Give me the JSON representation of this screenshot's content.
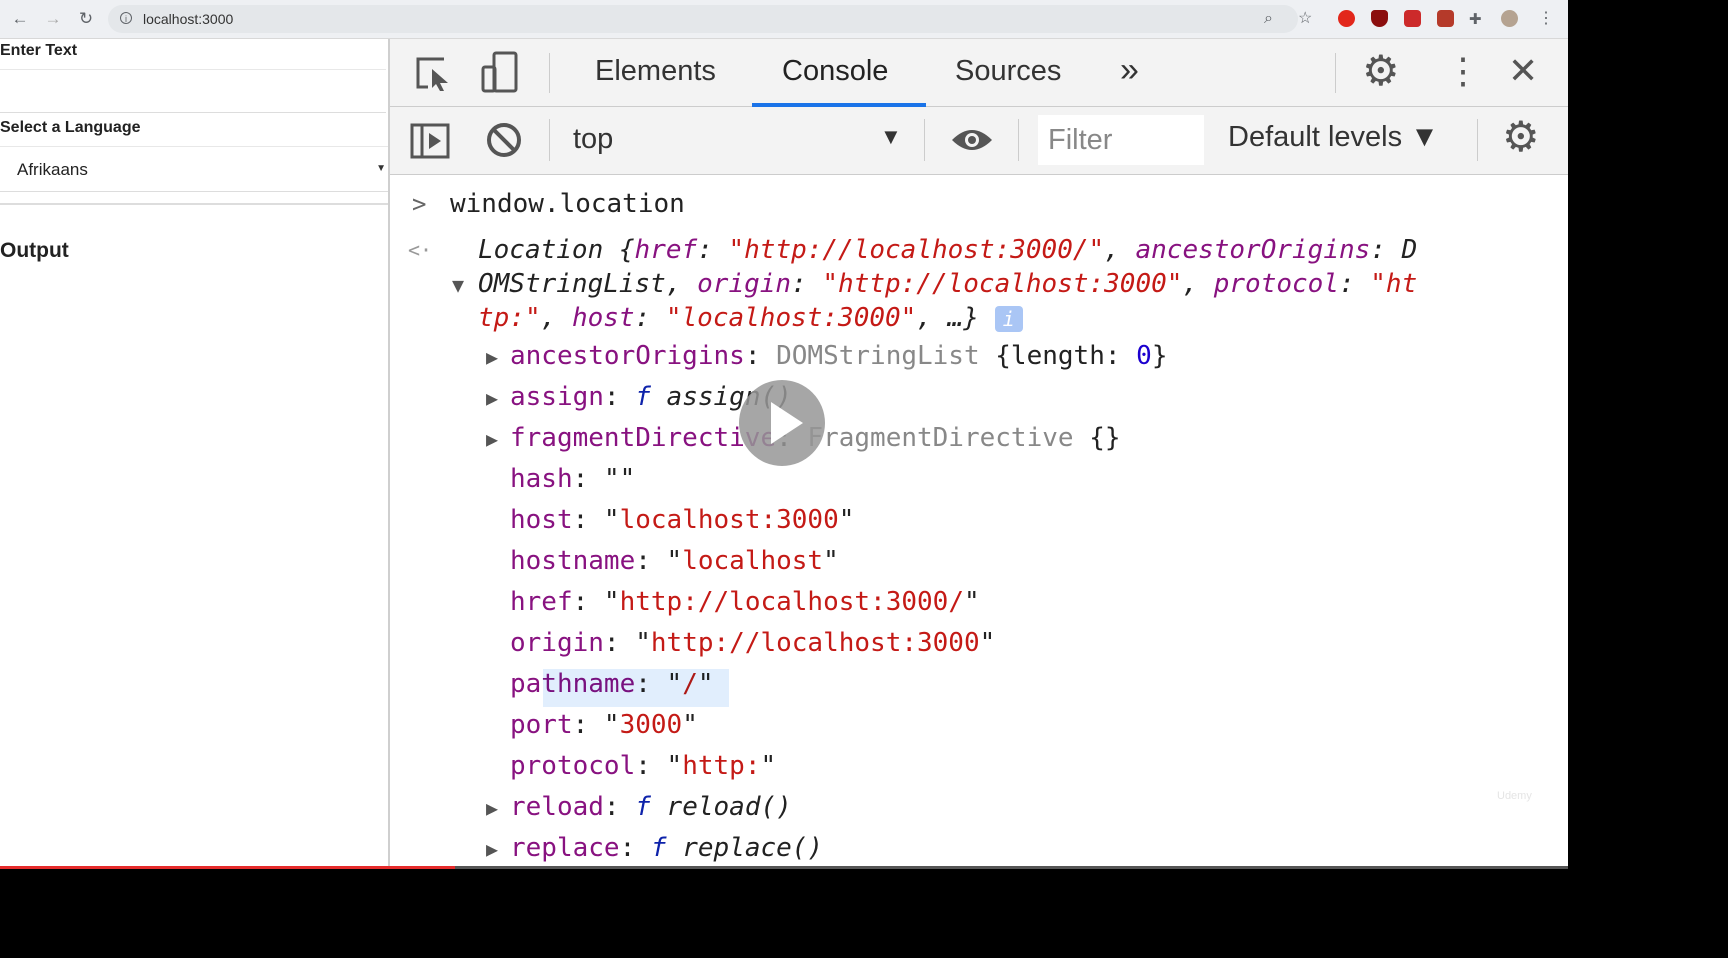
{
  "browser": {
    "url": "localhost:3000",
    "nav": {
      "back": "←",
      "forward": "→",
      "reload": "↻"
    },
    "toolbar_icons": [
      "zoom-icon",
      "star-icon",
      "opera-icon",
      "ublock-icon",
      "ext-red-icon",
      "ext-photo-icon",
      "puzzle-icon",
      "profile-avatar",
      "menu-icon"
    ]
  },
  "app": {
    "enter_text_label": "Enter Text",
    "enter_text_value": "",
    "language_label": "Select a Language",
    "language_value": "Afrikaans",
    "output_heading": "Output"
  },
  "devtools": {
    "tabs": [
      "Elements",
      "Console",
      "Sources"
    ],
    "active_tab": "Console",
    "more_tabs": "»",
    "context": "top",
    "filter_placeholder": "Filter",
    "levels": "Default levels ▼"
  },
  "console": {
    "input": "window.location",
    "summary": {
      "l1_a": "Location {",
      "l1_b": "href",
      "l1_c": ": ",
      "l1_d": "\"http://localhost:3000/\"",
      "l1_e": ", ",
      "l1_f": "ancestorOrigins",
      "l1_g": ": D",
      "l2_a": "OMStringList, ",
      "l2_b": "origin",
      "l2_c": ": ",
      "l2_d": "\"http://localhost:3000\"",
      "l2_e": ", ",
      "l2_f": "protocol",
      "l2_g": ": ",
      "l2_h": "\"ht",
      "l3_a": "tp:\"",
      "l3_b": ", ",
      "l3_c": "host",
      "l3_d": ": ",
      "l3_e": "\"localhost:3000\"",
      "l3_f": ", …}",
      "info": "i"
    },
    "props": [
      {
        "key": "ancestorOrigins",
        "type": "DOMStringList",
        "rest": "{length: ",
        "num": "0",
        "end": "}",
        "expandable": true,
        "kind": "obj"
      },
      {
        "key": "assign",
        "fn": "f",
        "sig": "assign()",
        "expandable": true,
        "kind": "fn"
      },
      {
        "key": "fragmentDirective",
        "type": "FragmentDirective",
        "rest": "{}",
        "expandable": true,
        "kind": "obj2"
      },
      {
        "key": "hash",
        "value": "\"\"",
        "kind": "str"
      },
      {
        "key": "host",
        "value": "localhost:3000",
        "kind": "str"
      },
      {
        "key": "hostname",
        "value": "localhost",
        "kind": "str"
      },
      {
        "key": "href",
        "value": "http://localhost:3000/",
        "kind": "str"
      },
      {
        "key": "origin",
        "value": "http://localhost:3000",
        "kind": "str"
      },
      {
        "key": "pathname",
        "value": "/",
        "kind": "str"
      },
      {
        "key": "port",
        "value": "3000",
        "kind": "str"
      },
      {
        "key": "protocol",
        "value": "http:",
        "kind": "str"
      },
      {
        "key": "reload",
        "fn": "f",
        "sig": "reload()",
        "expandable": true,
        "kind": "fn"
      },
      {
        "key": "replace",
        "fn": "f",
        "sig": "replace()",
        "expandable": true,
        "kind": "fn"
      }
    ]
  },
  "video": {
    "watermark": "Udemy",
    "progress": 0.29
  }
}
